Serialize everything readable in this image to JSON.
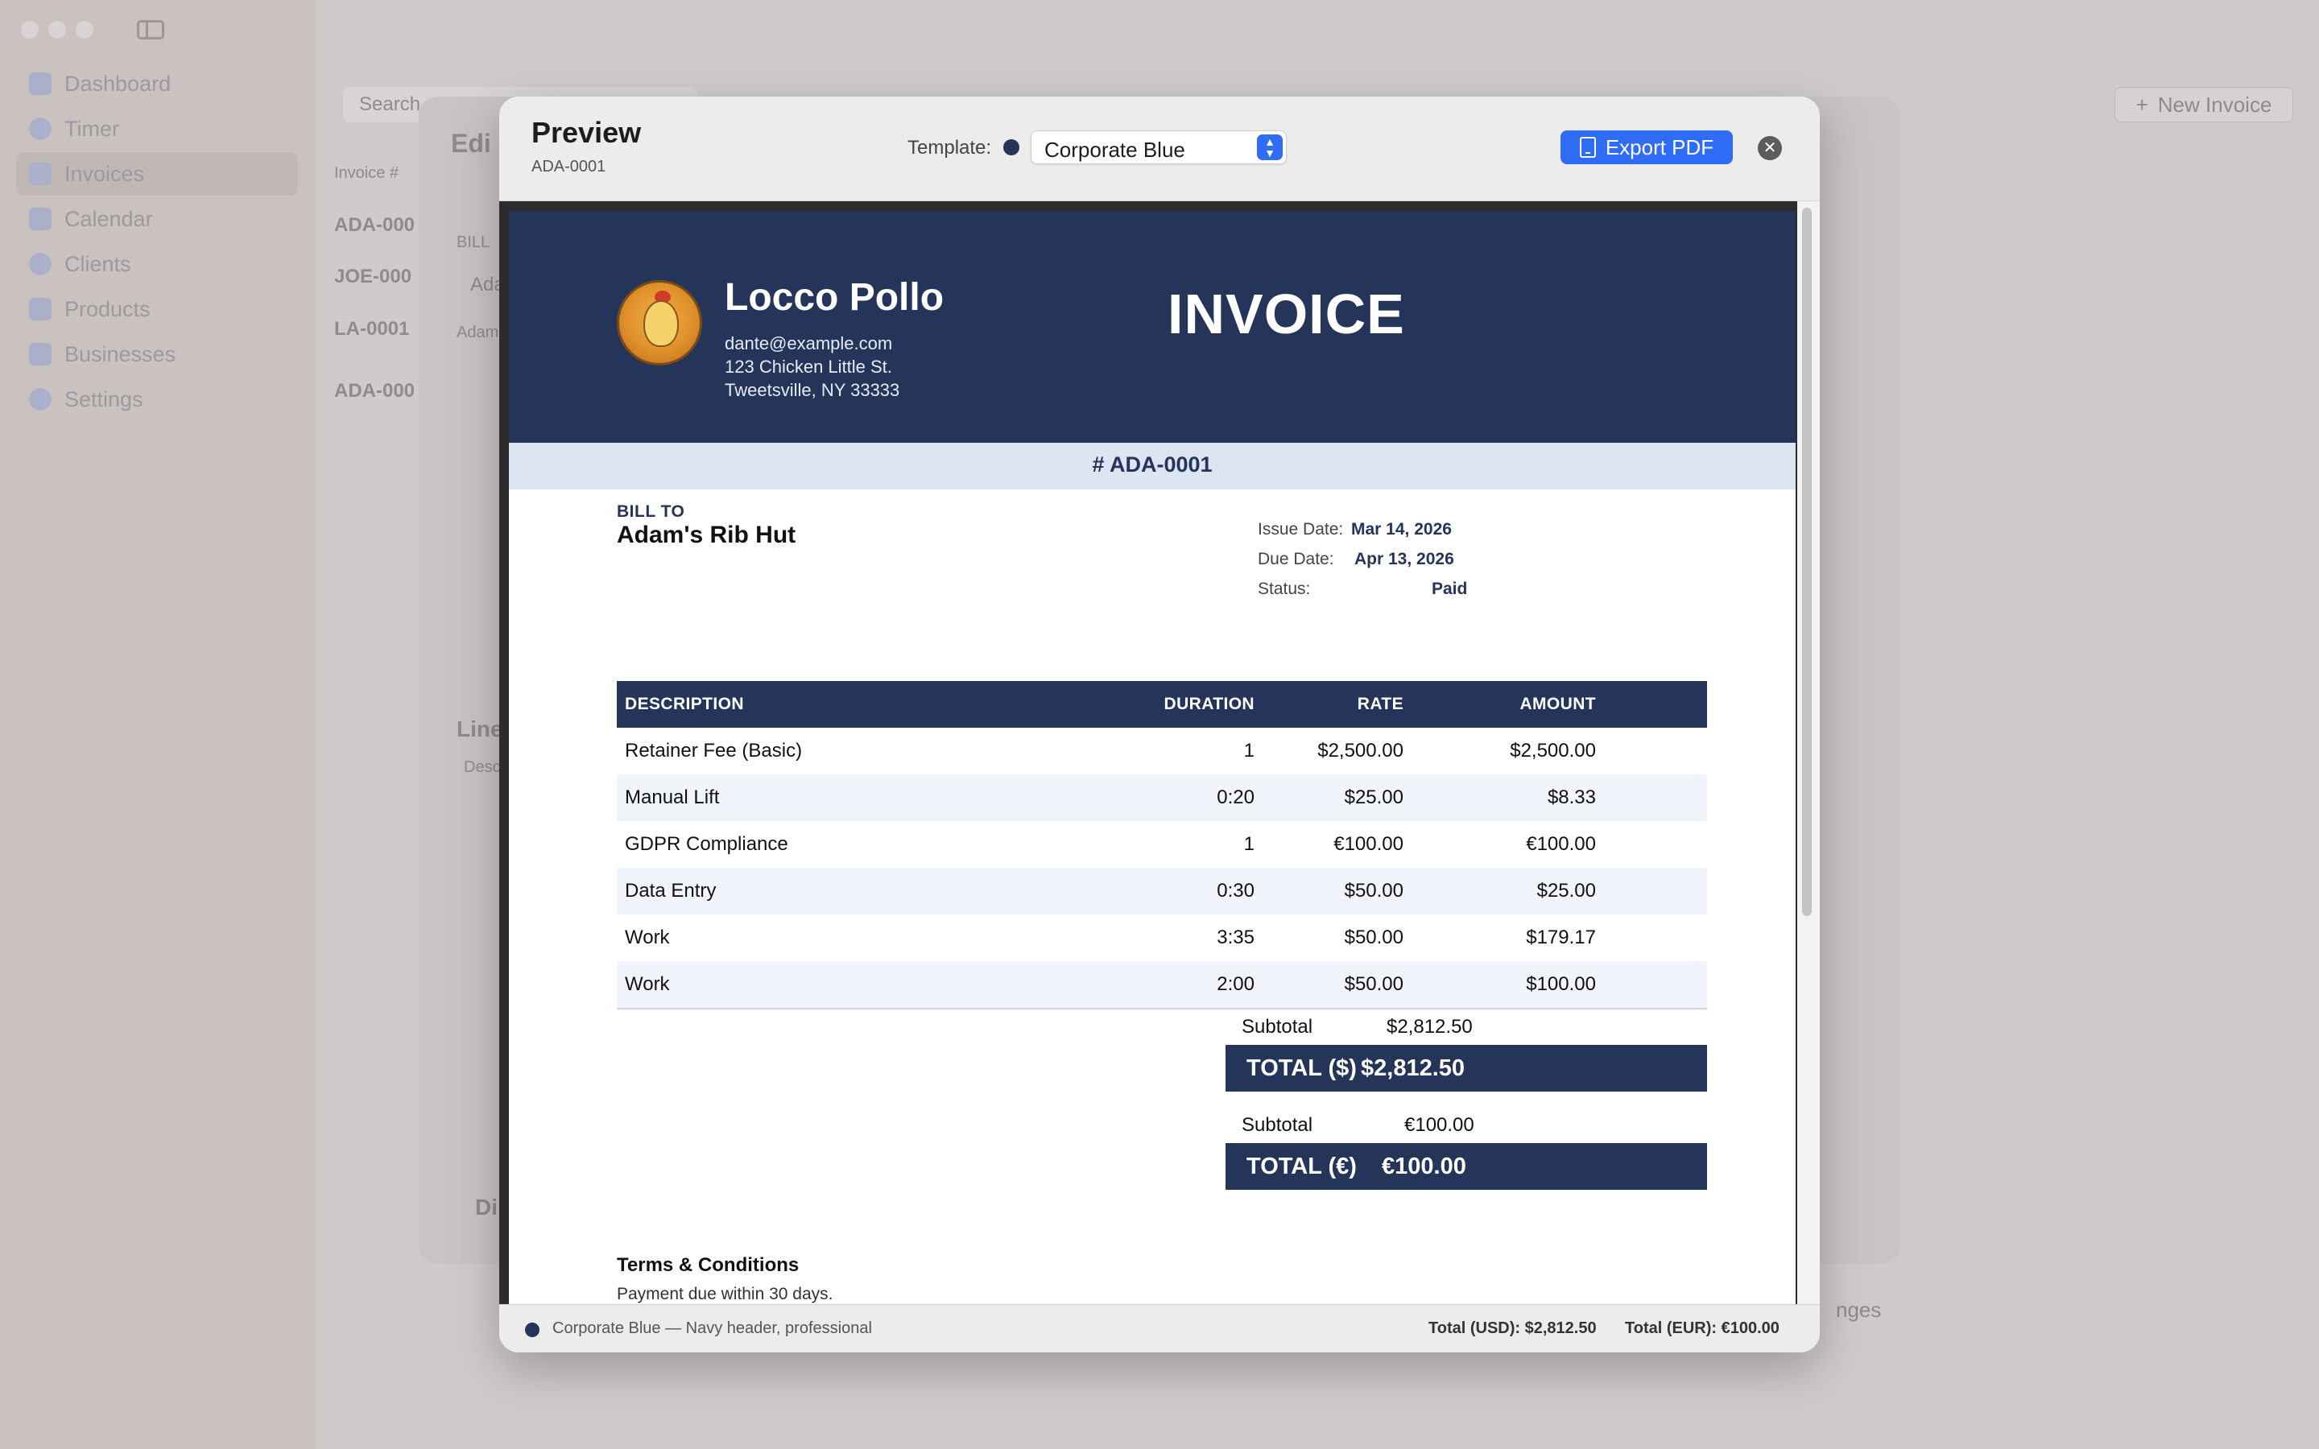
{
  "sidebar": {
    "items": [
      {
        "label": "Dashboard",
        "icon": "chart-icon"
      },
      {
        "label": "Timer",
        "icon": "clock-icon"
      },
      {
        "label": "Invoices",
        "icon": "document-icon"
      },
      {
        "label": "Calendar",
        "icon": "calendar-icon"
      },
      {
        "label": "Clients",
        "icon": "people-icon"
      },
      {
        "label": "Products",
        "icon": "box-icon"
      },
      {
        "label": "Businesses",
        "icon": "building-icon"
      },
      {
        "label": "Settings",
        "icon": "gear-icon"
      }
    ]
  },
  "background": {
    "search_placeholder": "Search",
    "new_invoice_label": "New Invoice",
    "invoice_col": "Invoice #",
    "invoice_ids": [
      "ADA-000",
      "JOE-000",
      "LA-0001",
      "ADA-000"
    ],
    "edit_title": "Edi",
    "bill_to_label": "BILL",
    "client_short": "Ada",
    "client_sub": "Adam",
    "line_items_label": "Line",
    "desc_label": "Desc",
    "discount_label": "Di",
    "changes_label": "nges"
  },
  "modal": {
    "title": "Preview",
    "invoice_number": "ADA-0001",
    "template_label": "Template:",
    "template_value": "Corporate Blue",
    "export_label": "Export PDF",
    "close_symbol": "✕"
  },
  "invoice": {
    "business_name": "Locco Pollo",
    "email": "dante@example.com",
    "address1": "123 Chicken Little St.",
    "address2": "Tweetsville, NY 33333",
    "title": "INVOICE",
    "number_display": "# ADA-0001",
    "bill_to_label": "BILL TO",
    "client_name": "Adam's Rib Hut",
    "issue_date_label": "Issue Date:",
    "issue_date": "Mar 14, 2026",
    "due_date_label": "Due Date:",
    "due_date": "Apr 13, 2026",
    "status_label": "Status:",
    "status": "Paid",
    "columns": [
      "DESCRIPTION",
      "DURATION",
      "RATE",
      "AMOUNT"
    ],
    "items": [
      {
        "description": "Retainer Fee (Basic)",
        "duration": "1",
        "rate": "$2,500.00",
        "amount": "$2,500.00"
      },
      {
        "description": "Manual Lift",
        "duration": "0:20",
        "rate": "$25.00",
        "amount": "$8.33"
      },
      {
        "description": "GDPR Compliance",
        "duration": "1",
        "rate": "€100.00",
        "amount": "€100.00"
      },
      {
        "description": "Data Entry",
        "duration": "0:30",
        "rate": "$50.00",
        "amount": "$25.00"
      },
      {
        "description": "Work",
        "duration": "3:35",
        "rate": "$50.00",
        "amount": "$179.17"
      },
      {
        "description": "Work",
        "duration": "2:00",
        "rate": "$50.00",
        "amount": "$100.00"
      }
    ],
    "subtotal_label": "Subtotal",
    "subtotal_usd": "$2,812.50",
    "total_usd_label": "TOTAL ($)",
    "total_usd": "$2,812.50",
    "subtotal_eur": "€100.00",
    "total_eur_label": "TOTAL (€)",
    "total_eur": "€100.00",
    "terms_title": "Terms & Conditions",
    "terms_text": "Payment due within 30 days."
  },
  "footer": {
    "template_desc": "Corporate Blue — Navy header, professional",
    "total_usd": "Total (USD): $2,812.50",
    "total_eur": "Total (EUR): €100.00"
  },
  "colors": {
    "navy": "#243559",
    "accent": "#2f6df6",
    "band": "#dde5f3"
  }
}
